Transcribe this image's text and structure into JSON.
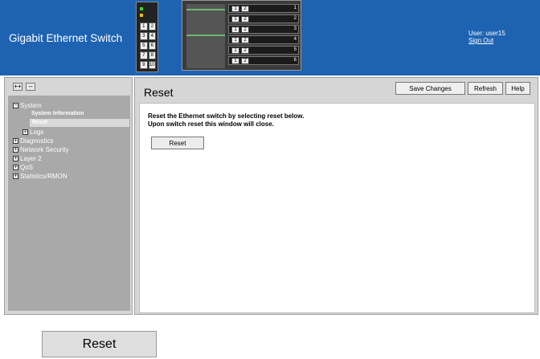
{
  "header": {
    "title": "Gigabit Ethernet Switch",
    "user_label": "User: user15",
    "signout": "Sign Out"
  },
  "sidebar": {
    "expand_all": "++",
    "collapse_all": "--",
    "tree": {
      "system": "System",
      "system_info": "System Information",
      "reset": "Reset",
      "logs": "Logs",
      "diagnostics": "Diagnostics",
      "network_security": "Network Security",
      "layer2": "Layer 2",
      "qos": "QoS",
      "statistics": "Statistics/RMON"
    }
  },
  "main": {
    "title": "Reset",
    "toolbar": {
      "save": "Save Changes",
      "refresh": "Refresh",
      "help": "Help"
    },
    "message_line1": "Reset the Ethernet switch by selecting reset below.",
    "message_line2": "Upon switch reset this window will close.",
    "reset_button": "Reset"
  },
  "callout": {
    "reset_button": "Reset"
  },
  "graphics": {
    "panel_ports": [
      [
        "1",
        "2"
      ],
      [
        "3",
        "4"
      ],
      [
        "5",
        "6"
      ],
      [
        "7",
        "8"
      ],
      [
        "9",
        "10"
      ]
    ],
    "chassis_slots": [
      {
        "a": "1",
        "b": "2",
        "num": "1"
      },
      {
        "a": "1",
        "b": "2",
        "num": "2"
      },
      {
        "a": "1",
        "b": "2",
        "num": "3"
      },
      {
        "a": "1",
        "b": "2",
        "num": "4"
      },
      {
        "a": "1",
        "b": "2",
        "num": "5"
      },
      {
        "a": "1",
        "b": "2",
        "num": "6"
      }
    ]
  },
  "colors": {
    "header_bg": "#1e63b2",
    "panel_bg": "#d6d6d6",
    "tree_bg": "#a9a9a9"
  }
}
